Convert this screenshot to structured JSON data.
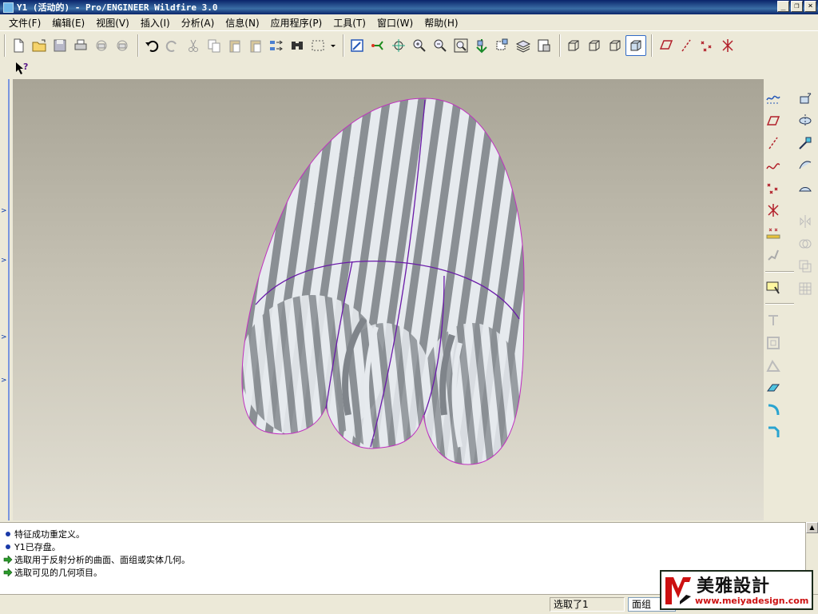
{
  "window": {
    "title": "Y1 (活动的) - Pro/ENGINEER Wildfire 3.0",
    "controls": [
      "_",
      "❐",
      "×"
    ]
  },
  "menubar": {
    "items": [
      "文件(F)",
      "编辑(E)",
      "视图(V)",
      "插入(I)",
      "分析(A)",
      "信息(N)",
      "应用程序(P)",
      "工具(T)",
      "窗口(W)",
      "帮助(H)"
    ]
  },
  "toolbar": {
    "top_icons": [
      "new-file-icon",
      "open-folder-icon",
      "save-icon",
      "print-icon",
      "send-mail-icon",
      "mail-icon",
      "undo-icon",
      "redo-icon",
      "cut-icon",
      "copy-icon",
      "paste-icon",
      "paste-special-icon",
      "regenerate-icon",
      "find-icon",
      "select-box-icon",
      "dropdown-icon",
      "repaint-icon",
      "spin-center-icon",
      "orient-icon",
      "zoom-in-icon",
      "zoom-out-icon",
      "refit-icon",
      "reorient-icon",
      "saved-views-icon",
      "layers-icon",
      "view-manager-icon",
      "wireframe-icon",
      "hidden-line-icon",
      "no-hidden-icon",
      "shading-icon",
      "datum-plane-display-icon",
      "datum-axis-display-icon",
      "datum-point-display-icon",
      "csys-display-icon"
    ],
    "context_help_icon": "context-help-icon"
  },
  "right_toolbar": {
    "icons": [
      "datum-curve-sketch-icon",
      "datum-plane-icon",
      "datum-axis-icon",
      "datum-curve-icon",
      "datum-point-icon",
      "offset-csys-icon",
      "point-field-icon",
      "csys-icon",
      "analysis-feature-icon",
      "sketch-tool-icon",
      "extrude-icon",
      "revolve-icon",
      "sweep-icon",
      "blend-icon",
      "boundary-blend-icon",
      "style-icon",
      "mirror-icon",
      "merge-icon",
      "trim-icon",
      "intersect-icon",
      "pattern-icon",
      "shell-icon",
      "draft-icon",
      "rib-icon",
      "round-icon",
      "chamfer-icon"
    ]
  },
  "messages": {
    "lines": [
      {
        "type": "info",
        "text": "特征成功重定义。"
      },
      {
        "type": "info",
        "text": "Y1已存盘。"
      },
      {
        "type": "prompt",
        "text": "选取用于反射分析的曲面、面组或实体几何。"
      },
      {
        "type": "prompt",
        "text": "选取可见的几何项目。"
      }
    ]
  },
  "status": {
    "selected": "选取了1",
    "filter": "面组"
  },
  "logo": {
    "chinese": "美雅設計",
    "url": "www.meiyadesign.com",
    "brand_color": "#cc1111"
  },
  "colors": {
    "title_bar": "#0a246a",
    "chrome": "#ece9d8",
    "model_light": "#e6eaee",
    "model_dark": "#8a8f94",
    "edge_highlight": "#8a1fb5"
  }
}
